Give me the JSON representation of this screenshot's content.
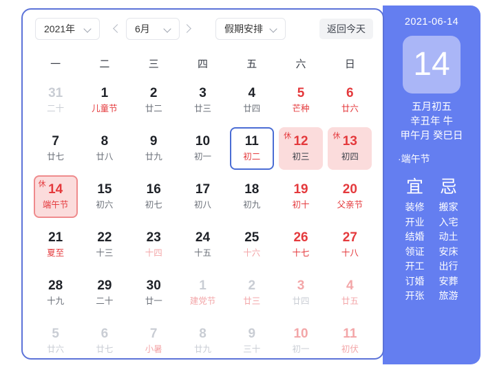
{
  "toolbar": {
    "year_label": "2021年",
    "month_label": "6月",
    "holiday_label": "假期安排",
    "today_button": "返回今天",
    "prev_icon": "chevron-left-icon",
    "next_icon": "chevron-right-icon"
  },
  "weekdays": [
    "一",
    "二",
    "三",
    "四",
    "五",
    "六",
    "日"
  ],
  "rest_badge": "休",
  "days": [
    {
      "num": "31",
      "lunar": "二十",
      "out": true,
      "weekend": false,
      "festival": false
    },
    {
      "num": "1",
      "lunar": "儿童节",
      "out": false,
      "weekend": false,
      "lunarRed": true
    },
    {
      "num": "2",
      "lunar": "廿二",
      "out": false,
      "weekend": false
    },
    {
      "num": "3",
      "lunar": "廿三",
      "out": false,
      "weekend": false
    },
    {
      "num": "4",
      "lunar": "廿四",
      "out": false,
      "weekend": false
    },
    {
      "num": "5",
      "lunar": "芒种",
      "out": false,
      "weekend": true
    },
    {
      "num": "6",
      "lunar": "廿六",
      "out": false,
      "weekend": true
    },
    {
      "num": "7",
      "lunar": "廿七",
      "out": false,
      "weekend": false
    },
    {
      "num": "8",
      "lunar": "廿八",
      "out": false,
      "weekend": false
    },
    {
      "num": "9",
      "lunar": "廿九",
      "out": false,
      "weekend": false
    },
    {
      "num": "10",
      "lunar": "初一",
      "out": false,
      "weekend": false
    },
    {
      "num": "11",
      "lunar": "初二",
      "out": false,
      "weekend": false,
      "selected": true,
      "lunarRed": true
    },
    {
      "num": "12",
      "lunar": "初三",
      "out": false,
      "weekend": true,
      "rest": true
    },
    {
      "num": "13",
      "lunar": "初四",
      "out": false,
      "weekend": true,
      "rest": true
    },
    {
      "num": "14",
      "lunar": "端午节",
      "out": false,
      "weekend": false,
      "rest": true,
      "today": true
    },
    {
      "num": "15",
      "lunar": "初六",
      "out": false,
      "weekend": false
    },
    {
      "num": "16",
      "lunar": "初七",
      "out": false,
      "weekend": false
    },
    {
      "num": "17",
      "lunar": "初八",
      "out": false,
      "weekend": false
    },
    {
      "num": "18",
      "lunar": "初九",
      "out": false,
      "weekend": false
    },
    {
      "num": "19",
      "lunar": "初十",
      "out": false,
      "weekend": true
    },
    {
      "num": "20",
      "lunar": "父亲节",
      "out": false,
      "weekend": true
    },
    {
      "num": "21",
      "lunar": "夏至",
      "out": false,
      "weekend": false,
      "lunarRed": true
    },
    {
      "num": "22",
      "lunar": "十三",
      "out": false,
      "weekend": false
    },
    {
      "num": "23",
      "lunar": "十四",
      "out": false,
      "weekend": false,
      "lunarPink": true
    },
    {
      "num": "24",
      "lunar": "十五",
      "out": false,
      "weekend": false
    },
    {
      "num": "25",
      "lunar": "十六",
      "out": false,
      "weekend": false,
      "lunarPink": true
    },
    {
      "num": "26",
      "lunar": "十七",
      "out": false,
      "weekend": true
    },
    {
      "num": "27",
      "lunar": "十八",
      "out": false,
      "weekend": true
    },
    {
      "num": "28",
      "lunar": "十九",
      "out": false,
      "weekend": false
    },
    {
      "num": "29",
      "lunar": "二十",
      "out": false,
      "weekend": false
    },
    {
      "num": "30",
      "lunar": "廿一",
      "out": false,
      "weekend": false
    },
    {
      "num": "1",
      "lunar": "建党节",
      "out": true,
      "weekend": false,
      "festival": true
    },
    {
      "num": "2",
      "lunar": "廿三",
      "out": true,
      "weekend": false,
      "festival": true
    },
    {
      "num": "3",
      "lunar": "廿四",
      "out": true,
      "weekend": true
    },
    {
      "num": "4",
      "lunar": "廿五",
      "out": true,
      "weekend": true,
      "festival": true
    },
    {
      "num": "5",
      "lunar": "廿六",
      "out": true,
      "weekend": false
    },
    {
      "num": "6",
      "lunar": "廿七",
      "out": true,
      "weekend": false
    },
    {
      "num": "7",
      "lunar": "小暑",
      "out": true,
      "weekend": false,
      "festival": true
    },
    {
      "num": "8",
      "lunar": "廿九",
      "out": true,
      "weekend": false
    },
    {
      "num": "9",
      "lunar": "三十",
      "out": true,
      "weekend": false
    },
    {
      "num": "10",
      "lunar": "初一",
      "out": true,
      "weekend": true
    },
    {
      "num": "11",
      "lunar": "初伏",
      "out": true,
      "weekend": true,
      "festival": true
    }
  ],
  "side": {
    "iso_date": "2021-06-14",
    "big_day": "14",
    "lunar_date": "五月初五",
    "ganzhi_year": "辛丑年 牛",
    "ganzhi_month_day": "甲午月 癸巳日",
    "festival": "·端午节",
    "yi_head": "宜",
    "ji_head": "忌",
    "yi_items": [
      "装修",
      "开业",
      "结婚",
      "领证",
      "开工",
      "订婚",
      "开张"
    ],
    "ji_items": [
      "搬家",
      "入宅",
      "动土",
      "安床",
      "出行",
      "安葬",
      "旅游"
    ]
  },
  "colors": {
    "accent_blue": "#5b72d8",
    "panel_blue": "#647ef0",
    "big_box_blue": "#aab6f7",
    "red": "#e4393c",
    "rest_bg": "#fbdcdc",
    "muted": "#c9cdd4"
  }
}
